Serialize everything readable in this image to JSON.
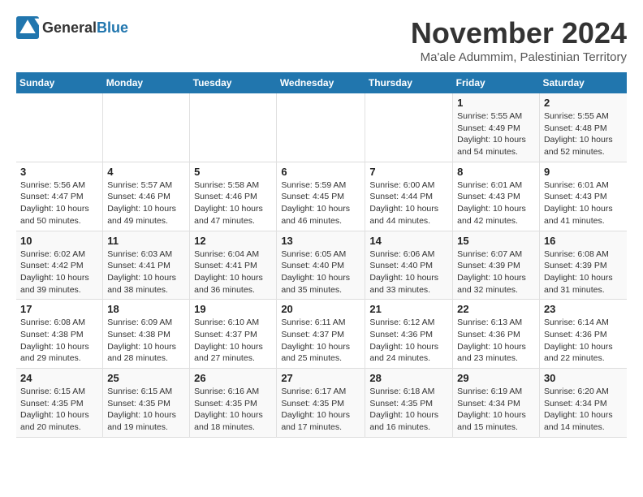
{
  "header": {
    "logo_general": "General",
    "logo_blue": "Blue",
    "month_title": "November 2024",
    "location": "Ma'ale Adummim, Palestinian Territory"
  },
  "weekdays": [
    "Sunday",
    "Monday",
    "Tuesday",
    "Wednesday",
    "Thursday",
    "Friday",
    "Saturday"
  ],
  "weeks": [
    [
      {
        "day": "",
        "info": ""
      },
      {
        "day": "",
        "info": ""
      },
      {
        "day": "",
        "info": ""
      },
      {
        "day": "",
        "info": ""
      },
      {
        "day": "",
        "info": ""
      },
      {
        "day": "1",
        "info": "Sunrise: 5:55 AM\nSunset: 4:49 PM\nDaylight: 10 hours and 54 minutes."
      },
      {
        "day": "2",
        "info": "Sunrise: 5:55 AM\nSunset: 4:48 PM\nDaylight: 10 hours and 52 minutes."
      }
    ],
    [
      {
        "day": "3",
        "info": "Sunrise: 5:56 AM\nSunset: 4:47 PM\nDaylight: 10 hours and 50 minutes."
      },
      {
        "day": "4",
        "info": "Sunrise: 5:57 AM\nSunset: 4:46 PM\nDaylight: 10 hours and 49 minutes."
      },
      {
        "day": "5",
        "info": "Sunrise: 5:58 AM\nSunset: 4:46 PM\nDaylight: 10 hours and 47 minutes."
      },
      {
        "day": "6",
        "info": "Sunrise: 5:59 AM\nSunset: 4:45 PM\nDaylight: 10 hours and 46 minutes."
      },
      {
        "day": "7",
        "info": "Sunrise: 6:00 AM\nSunset: 4:44 PM\nDaylight: 10 hours and 44 minutes."
      },
      {
        "day": "8",
        "info": "Sunrise: 6:01 AM\nSunset: 4:43 PM\nDaylight: 10 hours and 42 minutes."
      },
      {
        "day": "9",
        "info": "Sunrise: 6:01 AM\nSunset: 4:43 PM\nDaylight: 10 hours and 41 minutes."
      }
    ],
    [
      {
        "day": "10",
        "info": "Sunrise: 6:02 AM\nSunset: 4:42 PM\nDaylight: 10 hours and 39 minutes."
      },
      {
        "day": "11",
        "info": "Sunrise: 6:03 AM\nSunset: 4:41 PM\nDaylight: 10 hours and 38 minutes."
      },
      {
        "day": "12",
        "info": "Sunrise: 6:04 AM\nSunset: 4:41 PM\nDaylight: 10 hours and 36 minutes."
      },
      {
        "day": "13",
        "info": "Sunrise: 6:05 AM\nSunset: 4:40 PM\nDaylight: 10 hours and 35 minutes."
      },
      {
        "day": "14",
        "info": "Sunrise: 6:06 AM\nSunset: 4:40 PM\nDaylight: 10 hours and 33 minutes."
      },
      {
        "day": "15",
        "info": "Sunrise: 6:07 AM\nSunset: 4:39 PM\nDaylight: 10 hours and 32 minutes."
      },
      {
        "day": "16",
        "info": "Sunrise: 6:08 AM\nSunset: 4:39 PM\nDaylight: 10 hours and 31 minutes."
      }
    ],
    [
      {
        "day": "17",
        "info": "Sunrise: 6:08 AM\nSunset: 4:38 PM\nDaylight: 10 hours and 29 minutes."
      },
      {
        "day": "18",
        "info": "Sunrise: 6:09 AM\nSunset: 4:38 PM\nDaylight: 10 hours and 28 minutes."
      },
      {
        "day": "19",
        "info": "Sunrise: 6:10 AM\nSunset: 4:37 PM\nDaylight: 10 hours and 27 minutes."
      },
      {
        "day": "20",
        "info": "Sunrise: 6:11 AM\nSunset: 4:37 PM\nDaylight: 10 hours and 25 minutes."
      },
      {
        "day": "21",
        "info": "Sunrise: 6:12 AM\nSunset: 4:36 PM\nDaylight: 10 hours and 24 minutes."
      },
      {
        "day": "22",
        "info": "Sunrise: 6:13 AM\nSunset: 4:36 PM\nDaylight: 10 hours and 23 minutes."
      },
      {
        "day": "23",
        "info": "Sunrise: 6:14 AM\nSunset: 4:36 PM\nDaylight: 10 hours and 22 minutes."
      }
    ],
    [
      {
        "day": "24",
        "info": "Sunrise: 6:15 AM\nSunset: 4:35 PM\nDaylight: 10 hours and 20 minutes."
      },
      {
        "day": "25",
        "info": "Sunrise: 6:15 AM\nSunset: 4:35 PM\nDaylight: 10 hours and 19 minutes."
      },
      {
        "day": "26",
        "info": "Sunrise: 6:16 AM\nSunset: 4:35 PM\nDaylight: 10 hours and 18 minutes."
      },
      {
        "day": "27",
        "info": "Sunrise: 6:17 AM\nSunset: 4:35 PM\nDaylight: 10 hours and 17 minutes."
      },
      {
        "day": "28",
        "info": "Sunrise: 6:18 AM\nSunset: 4:35 PM\nDaylight: 10 hours and 16 minutes."
      },
      {
        "day": "29",
        "info": "Sunrise: 6:19 AM\nSunset: 4:34 PM\nDaylight: 10 hours and 15 minutes."
      },
      {
        "day": "30",
        "info": "Sunrise: 6:20 AM\nSunset: 4:34 PM\nDaylight: 10 hours and 14 minutes."
      }
    ]
  ]
}
